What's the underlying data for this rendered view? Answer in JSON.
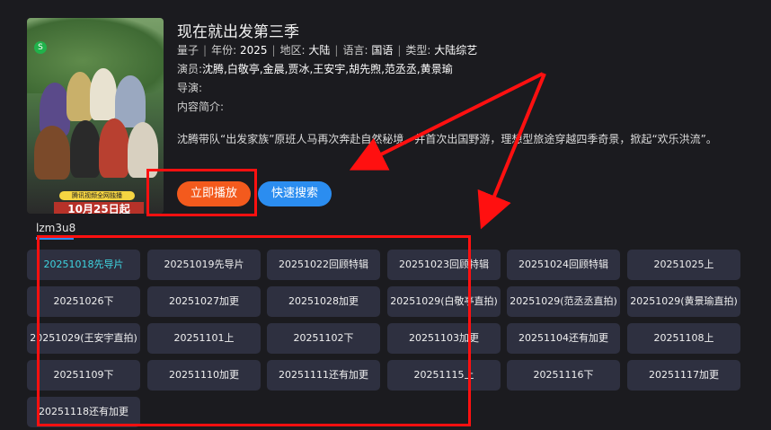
{
  "show": {
    "title": "现在就出发第三季",
    "source_site": "量子",
    "year_label": "年份:",
    "year": "2025",
    "region_label": "地区:",
    "region": "大陆",
    "language_label": "语言:",
    "language": "国语",
    "type_label": "类型:",
    "type": "大陆综艺",
    "actors_label": "演员:",
    "actors": "沈腾,白敬亭,金晨,贾冰,王安宇,胡先煦,范丞丞,黄景瑜",
    "director_label": "导演:",
    "director": "",
    "intro_label": "内容简介:",
    "description": "沈腾带队“出发家族”原班人马再次奔赴自然秘境，并首次出国野游，理想型旅途穿越四季奇景，掀起“欢乐洪流”。"
  },
  "poster": {
    "banner_text": "腾讯视频全网独播",
    "date_text": "10月25日起"
  },
  "buttons": {
    "play": "立即播放",
    "search": "快速搜索"
  },
  "source_tab": "lzm3u8",
  "episodes": [
    "20251018先导片",
    "20251019先导片",
    "20251022回顾特辑",
    "20251023回顾特辑",
    "20251024回顾特辑",
    "20251025上",
    "20251026下",
    "20251027加更",
    "20251028加更",
    "20251029(白敬亭直拍)",
    "20251029(范丞丞直拍)",
    "20251029(黄景瑜直拍)",
    "20251029(王安宇直拍)",
    "20251101上",
    "20251102下",
    "20251103加更",
    "20251104还有加更",
    "20251108上",
    "20251109下",
    "20251110加更",
    "20251111还有加更",
    "20251115上",
    "20251116下",
    "20251117加更",
    "20251118还有加更"
  ],
  "active_episode_index": 0,
  "colors": {
    "background": "#1b1b1f",
    "play_button": "#f35a1d",
    "search_button": "#2b8df0",
    "episode_bg": "#2e3040",
    "active_text": "#3fd4e0",
    "annotation": "#ff1010"
  }
}
